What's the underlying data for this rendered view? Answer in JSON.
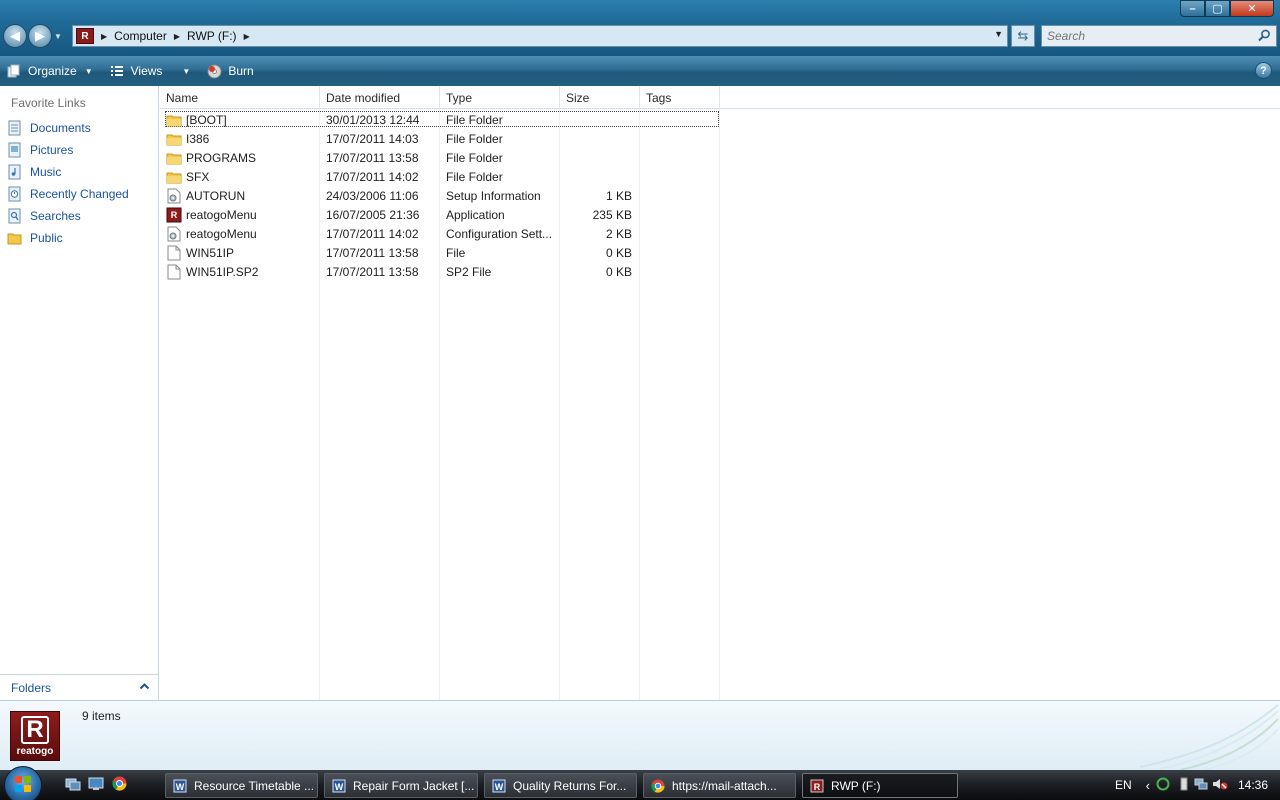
{
  "window": {
    "controls": {
      "minimize": "–",
      "maximize": "▢",
      "close": "✕"
    }
  },
  "address": {
    "crumbs": [
      "Computer",
      "RWP (F:)"
    ],
    "drive_icon_letter": "R"
  },
  "search": {
    "placeholder": "Search"
  },
  "toolbar": {
    "organize": "Organize",
    "views": "Views",
    "burn": "Burn",
    "help": "?"
  },
  "nav": {
    "title": "Favorite Links",
    "items": [
      {
        "label": "Documents",
        "icon": "documents-icon"
      },
      {
        "label": "Pictures",
        "icon": "pictures-icon"
      },
      {
        "label": "Music",
        "icon": "music-icon"
      },
      {
        "label": "Recently Changed",
        "icon": "recently-changed-icon"
      },
      {
        "label": "Searches",
        "icon": "searches-icon"
      },
      {
        "label": "Public",
        "icon": "public-folder-icon"
      }
    ],
    "folders_label": "Folders"
  },
  "columns": {
    "name": "Name",
    "date": "Date modified",
    "type": "Type",
    "size": "Size",
    "tags": "Tags"
  },
  "files": [
    {
      "name": "[BOOT]",
      "date": "30/01/2013 12:44",
      "type": "File Folder",
      "size": "",
      "icon": "folder"
    },
    {
      "name": "I386",
      "date": "17/07/2011 14:03",
      "type": "File Folder",
      "size": "",
      "icon": "folder"
    },
    {
      "name": "PROGRAMS",
      "date": "17/07/2011 13:58",
      "type": "File Folder",
      "size": "",
      "icon": "folder"
    },
    {
      "name": "SFX",
      "date": "17/07/2011 14:02",
      "type": "File Folder",
      "size": "",
      "icon": "folder"
    },
    {
      "name": "AUTORUN",
      "date": "24/03/2006 11:06",
      "type": "Setup Information",
      "size": "1 KB",
      "icon": "settings"
    },
    {
      "name": "reatogoMenu",
      "date": "16/07/2005 21:36",
      "type": "Application",
      "size": "235 KB",
      "icon": "app"
    },
    {
      "name": "reatogoMenu",
      "date": "17/07/2011 14:02",
      "type": "Configuration Sett...",
      "size": "2 KB",
      "icon": "settings"
    },
    {
      "name": "WIN51IP",
      "date": "17/07/2011 13:58",
      "type": "File",
      "size": "0 KB",
      "icon": "file"
    },
    {
      "name": "WIN51IP.SP2",
      "date": "17/07/2011 13:58",
      "type": "SP2 File",
      "size": "0 KB",
      "icon": "file"
    }
  ],
  "details": {
    "count": "9 items",
    "logo_letter": "R",
    "logo_text": "reatogo"
  },
  "taskbar": {
    "tasks": [
      {
        "label": "Resource Timetable ...",
        "icon": "word-icon"
      },
      {
        "label": "Repair Form Jacket [...",
        "icon": "word-icon"
      },
      {
        "label": "Quality Returns For...",
        "icon": "word-icon"
      },
      {
        "label": "https://mail-attach...",
        "icon": "chrome-icon"
      },
      {
        "label": "RWP (F:)",
        "icon": "reatogo-icon"
      }
    ],
    "lang": "EN",
    "clock": "14:36"
  }
}
